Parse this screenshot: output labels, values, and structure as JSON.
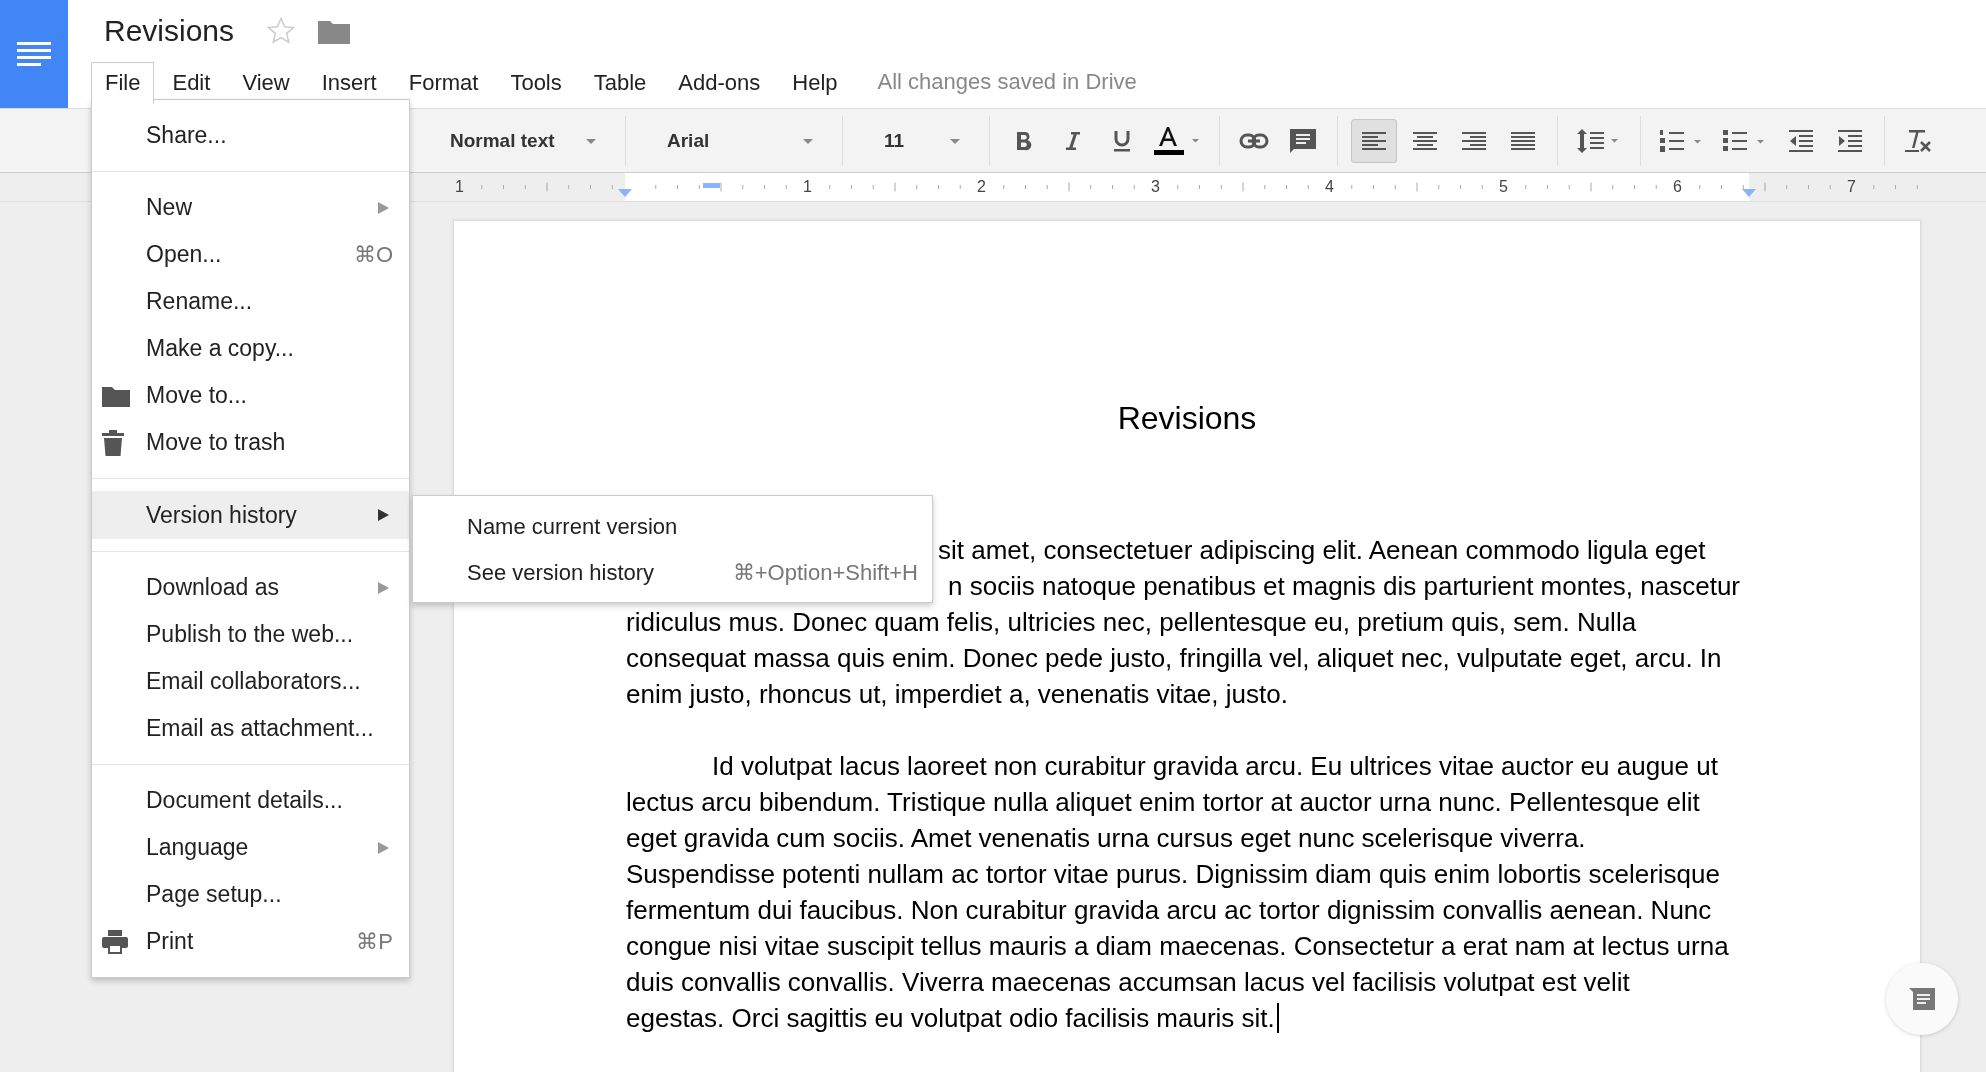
{
  "app": {
    "title": "Revisions",
    "starred": false
  },
  "menubar": {
    "items": [
      {
        "label": "File",
        "selected": true
      },
      {
        "label": "Edit",
        "selected": false
      },
      {
        "label": "View",
        "selected": false
      },
      {
        "label": "Insert",
        "selected": false
      },
      {
        "label": "Format",
        "selected": false
      },
      {
        "label": "Tools",
        "selected": false
      },
      {
        "label": "Table",
        "selected": false
      },
      {
        "label": "Add-ons",
        "selected": false
      },
      {
        "label": "Help",
        "selected": false
      }
    ],
    "status": "All changes saved in Drive"
  },
  "toolbar": {
    "style": "Normal text",
    "font": "Arial",
    "size": "11",
    "alignment": [
      {
        "kind": "left",
        "selected": true
      },
      {
        "kind": "center",
        "selected": false
      },
      {
        "kind": "right",
        "selected": false
      },
      {
        "kind": "justify",
        "selected": false
      }
    ]
  },
  "ruler": {
    "labels": [
      "1",
      "1",
      "2",
      "3",
      "4",
      "5",
      "6",
      "7"
    ]
  },
  "document": {
    "title": "Revisions",
    "paragraphs": [
      {
        "lines": [
          "sit amet, consectetuer adipiscing elit. Aenean commodo ligula eget",
          "n sociis natoque penatibus et magnis dis parturient montes, nascetur",
          "ridiculus mus. Donec quam felis, ultricies nec, pellentesque eu, pretium quis, sem. Nulla",
          "consequat massa quis enim. Donec pede justo, fringilla vel, aliquet nec, vulputate eget, arcu. In",
          "enim justo, rhoncus ut, imperdiet a, venenatis vitae, justo."
        ]
      },
      {
        "first_line_indent": true,
        "lines": [
          "Id volutpat lacus laoreet non curabitur gravida arcu. Eu ultrices vitae auctor eu augue ut",
          "lectus arcu bibendum. Tristique nulla aliquet enim tortor at auctor urna nunc. Pellentesque elit",
          "eget gravida cum sociis. Amet venenatis urna cursus eget nunc scelerisque viverra.",
          "Suspendisse potenti nullam ac tortor vitae purus. Dignissim diam quis enim lobortis scelerisque",
          "fermentum dui faucibus. Non curabitur gravida arcu ac tortor dignissim convallis aenean. Nunc",
          "congue nisi vitae suscipit tellus mauris a diam maecenas. Consectetur a erat nam at lectus urna",
          "duis convallis convallis. Viverra maecenas accumsan lacus vel facilisis volutpat est velit",
          "egestas. Orci sagittis eu volutpat odio facilisis mauris sit."
        ]
      }
    ]
  },
  "file_menu": {
    "sections": [
      [
        {
          "label": "Share...",
          "selected": false
        }
      ],
      [
        {
          "label": "New",
          "submenu": true,
          "selected": false
        },
        {
          "label": "Open...",
          "shortcut": "⌘O",
          "selected": false
        },
        {
          "label": "Rename...",
          "selected": false
        },
        {
          "label": "Make a copy...",
          "selected": false
        },
        {
          "label": "Move to...",
          "kind": "folder",
          "selected": false
        },
        {
          "label": "Move to trash",
          "kind": "trash",
          "selected": false
        }
      ],
      [
        {
          "label": "Version history",
          "submenu": true,
          "selected": true
        }
      ],
      [
        {
          "label": "Download as",
          "submenu": true,
          "selected": false
        },
        {
          "label": "Publish to the web...",
          "selected": false
        },
        {
          "label": "Email collaborators...",
          "selected": false
        },
        {
          "label": "Email as attachment...",
          "selected": false
        }
      ],
      [
        {
          "label": "Document details...",
          "selected": false
        },
        {
          "label": "Language",
          "submenu": true,
          "selected": false
        },
        {
          "label": "Page setup...",
          "selected": false
        },
        {
          "label": "Print",
          "kind": "print",
          "shortcut": "⌘P",
          "selected": false
        }
      ]
    ]
  },
  "version_submenu": {
    "items": [
      {
        "label": "Name current version"
      },
      {
        "label": "See version history",
        "shortcut": "⌘+Option+Shift+H"
      }
    ]
  }
}
